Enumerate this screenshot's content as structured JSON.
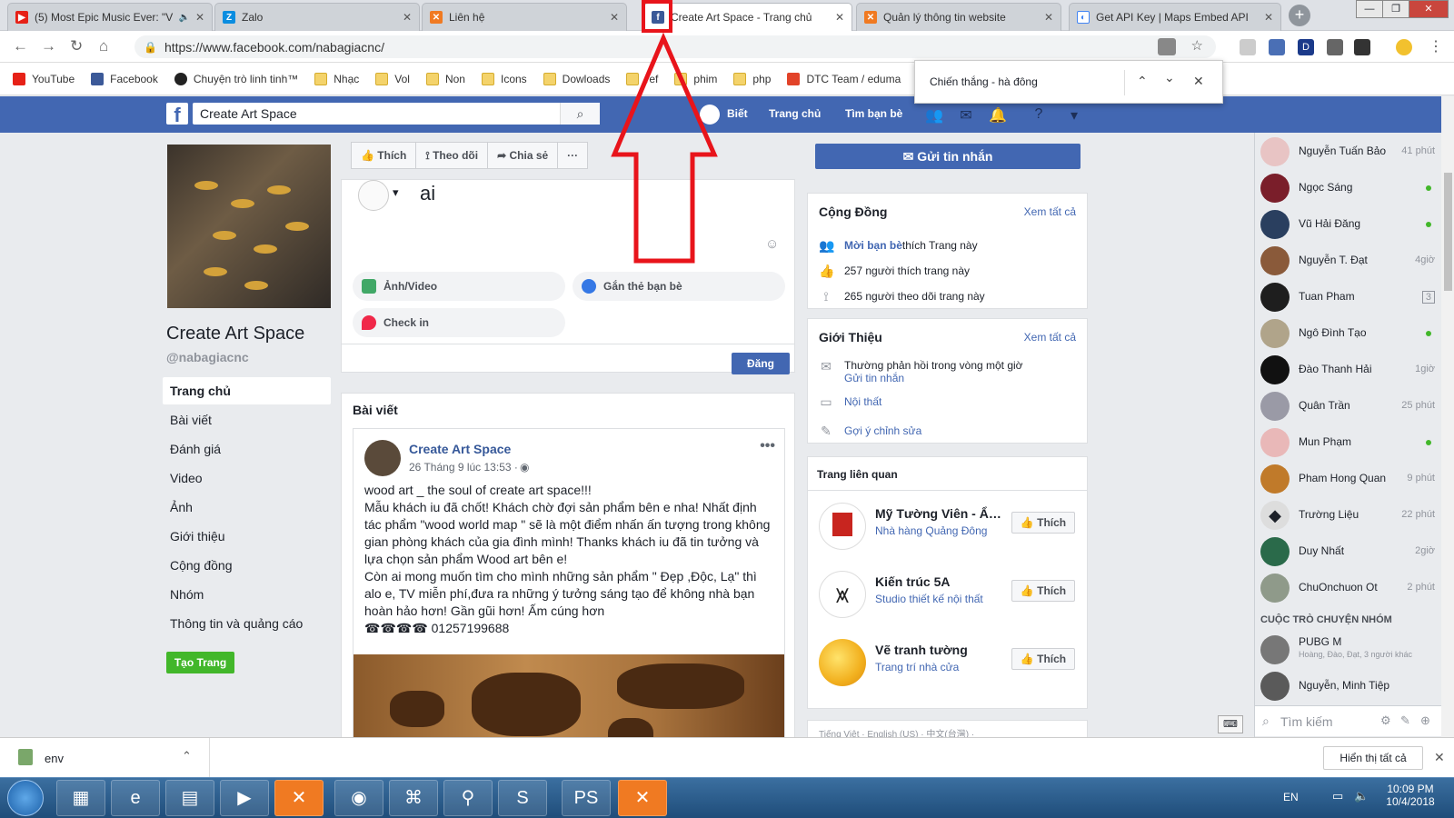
{
  "browser": {
    "tabs": [
      {
        "title": "(5) Most Epic Music Ever: \"V",
        "icon": "youtube-icon",
        "color": "#e62117",
        "active": false
      },
      {
        "title": "Zalo",
        "icon": "zalo-icon",
        "color": "#0a8de0",
        "active": false
      },
      {
        "title": "Liên hệ",
        "icon": "xampp-icon",
        "color": "#f07a22",
        "active": false
      },
      {
        "title": "Create Art Space - Trang chủ",
        "icon": "facebook-icon",
        "color": "#3b5998",
        "active": true
      },
      {
        "title": "Quản lý thông tin website",
        "icon": "xampp-icon",
        "color": "#f07a22",
        "active": false
      },
      {
        "title": "Get API Key  |  Maps Embed API",
        "icon": "google-icon",
        "color": "#4285f4",
        "active": false
      }
    ],
    "url": "https://www.facebook.com/nabagiacnc/",
    "bookmarks": [
      "YouTube",
      "Facebook",
      "Chuyện trò linh tinh™",
      "Nhạc",
      "Vol",
      "Non",
      "Icons",
      "Dowloads",
      "ref",
      "phim",
      "php",
      "DTC Team / eduma"
    ],
    "find_text": "Chiến thắng - hà đông",
    "extensions": [
      "D"
    ]
  },
  "fb": {
    "search_value": "Create Art Space",
    "nav": {
      "user": "Biết",
      "home": "Trang chủ",
      "find_friends": "Tìm bạn bè"
    },
    "page": {
      "name": "Create Art Space",
      "handle": "@nabagiacnc",
      "left_nav": [
        "Trang chủ",
        "Bài viết",
        "Đánh giá",
        "Video",
        "Ảnh",
        "Giới thiệu",
        "Cộng đồng",
        "Nhóm",
        "Thông tin và quảng cáo"
      ],
      "create_page": "Tạo Trang"
    },
    "actions": {
      "like": "Thích",
      "follow": "Theo dõi",
      "share": "Chia sẻ",
      "more": "···",
      "message": "Gửi tin nhắn"
    },
    "composer": {
      "text": "ai",
      "photo_video": "Ảnh/Video",
      "tag_friends": "Gắn thẻ bạn bè",
      "check_in": "Check in",
      "post_button": "Đăng"
    },
    "posts_header": "Bài viết",
    "post": {
      "author": "Create Art Space",
      "time": "26 Tháng 9 lúc 13:53 ·",
      "line1": "wood art _ the soul of create art space!!!",
      "para1": "Mẫu khách iu đã chốt! Khách chờ đợi sản phẩm bên e nha! Nhất định tác phẩm \"wood world map \" sẽ là một điểm nhấn ấn tượng trong không gian phòng khách của gia đình mình! Thanks khách iu đã tin tưởng và lựa chọn sản phẩm Wood art bên e!",
      "para2": "Còn ai mong muốn tìm cho mình những sản phẩm \" Đẹp ,Độc, Lạ\" thì alo e, TV miễn phí,đưa ra những ý tưởng sáng tạo để không nhà bạn hoàn hảo hơn! Gần gũi hơn! Ấm cúng hơn",
      "phone": "☎☎☎☎ 01257199688"
    },
    "community": {
      "title": "Cộng Đồng",
      "see_all": "Xem tất cả",
      "invite_bold": "Mời bạn bè",
      "invite_rest": " thích Trang này",
      "likes": "257 người thích trang này",
      "follows": "265 người theo dõi trang này"
    },
    "about": {
      "title": "Giới Thiệu",
      "see_all": "Xem tất cả",
      "response": "Thường phản hồi trong vòng một giờ",
      "send_msg": "Gửi tin nhắn",
      "category": "Nội thất",
      "suggest": "Gợi ý chỉnh sửa"
    },
    "related": {
      "title": "Trang liên quan",
      "like_label": "Thích",
      "items": [
        {
          "name": "Mỹ Tường Viên - Ẩm ...",
          "sub": "Nhà hàng Quảng Đông"
        },
        {
          "name": "Kiến trúc 5A",
          "sub": "Studio thiết kế nội thất"
        },
        {
          "name": "Vẽ tranh tường",
          "sub": "Trang trí nhà cửa"
        }
      ]
    },
    "footer_langs": "Tiếng Việt · English (US) · 中文(台灣) ·",
    "chat": {
      "contacts": [
        {
          "name": "Nguyễn Tuấn Bảo",
          "status": "41 phút",
          "online": false
        },
        {
          "name": "Ngọc Sáng",
          "status": "",
          "online": true
        },
        {
          "name": "Vũ Hải Đăng",
          "status": "",
          "online": true
        },
        {
          "name": "Nguyễn T. Đạt",
          "status": "4giờ",
          "online": false
        },
        {
          "name": "Tuan Pham",
          "status": "3",
          "online": false
        },
        {
          "name": "Ngô Đình Tạo",
          "status": "",
          "online": true
        },
        {
          "name": "Đào Thanh Hải",
          "status": "1giờ",
          "online": false
        },
        {
          "name": "Quân Trần",
          "status": "25 phút",
          "online": false
        },
        {
          "name": "Mun Phạm",
          "status": "",
          "online": true
        },
        {
          "name": "Pham Hong Quan",
          "status": "9 phút",
          "online": false
        },
        {
          "name": "Trường Liệu",
          "status": "22 phút",
          "online": false
        },
        {
          "name": "Duy Nhất",
          "status": "2giờ",
          "online": false
        },
        {
          "name": "ChuOnchuon Ot",
          "status": "2 phút",
          "online": false
        }
      ],
      "group_header": "CUỘC TRÒ CHUYỆN NHÓM",
      "groups": [
        {
          "name": "PUBG M",
          "sub": "Hoàng, Đào, Đạt, 3 người khác"
        },
        {
          "name": "Nguyễn, Minh Tiệp",
          "sub": ""
        }
      ],
      "search_placeholder": "Tìm kiếm"
    }
  },
  "download": {
    "file": "env",
    "show_all": "Hiển thị tất cả"
  },
  "taskbar": {
    "lang": "EN",
    "time": "10:09 PM",
    "date": "10/4/2018"
  },
  "colors": {
    "fb_blue": "#4267b2",
    "annotation_red": "#e8141b",
    "green": "#42b72a"
  }
}
